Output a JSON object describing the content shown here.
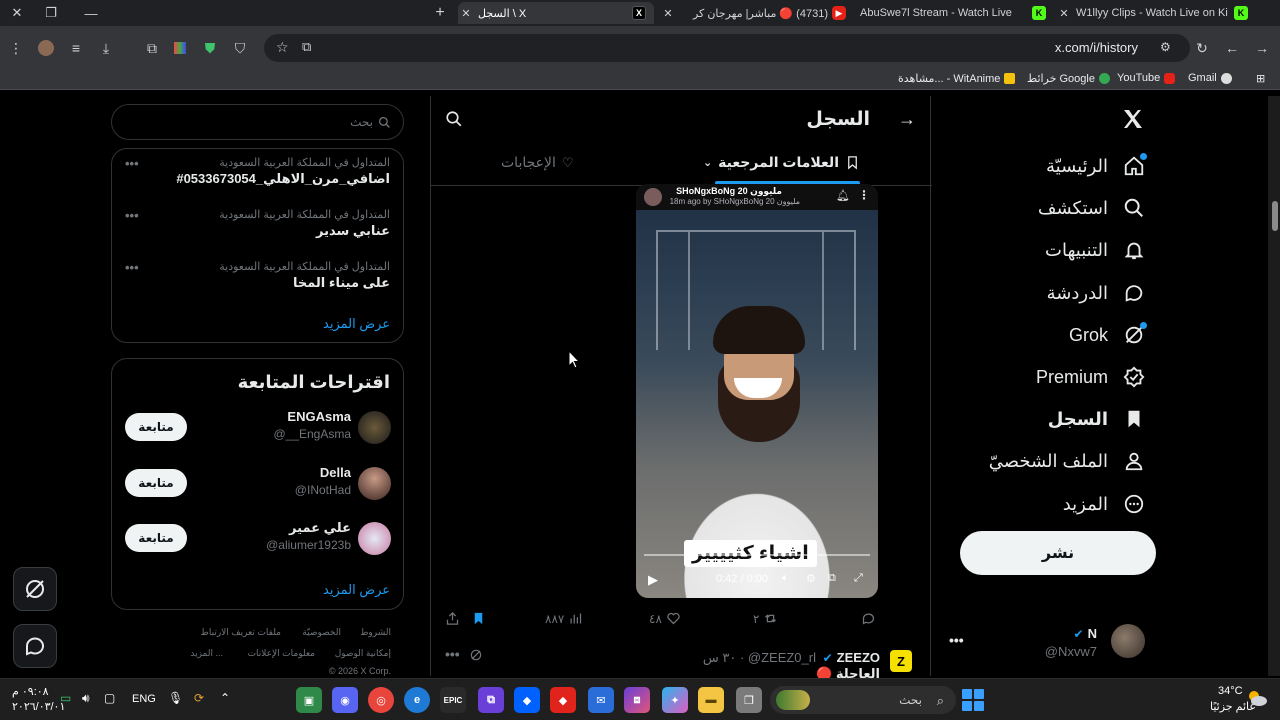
{
  "browser": {
    "tabs": [
      {
        "title": "السجل \\ X",
        "favicon": "x-favicon",
        "active": true
      },
      {
        "title": "(4731) 🔴 مباشر| مهرجان كر",
        "favicon": "youtube-favicon",
        "active": false
      },
      {
        "title": "AbuSwe7l Stream - Watch Live",
        "favicon": "kick-favicon",
        "active": false
      },
      {
        "title": "W1llyy Clips - Watch Live on Ki",
        "favicon": "kick-favicon",
        "active": false
      }
    ],
    "url": "x.com/i/history",
    "bookmarks": [
      {
        "label": "Gmail",
        "icon": "gmail-icon"
      },
      {
        "label": "YouTube",
        "icon": "youtube-icon"
      },
      {
        "label": "خرائط Google",
        "icon": "maps-icon"
      },
      {
        "label": "مشاهدة... - WitAnime",
        "icon": "witanime-icon"
      }
    ]
  },
  "nav": {
    "items": [
      {
        "label": "الرئيسيّة",
        "icon": "home-icon",
        "bold": false,
        "dot": true
      },
      {
        "label": "استكشف",
        "icon": "search-icon",
        "bold": false,
        "dot": false
      },
      {
        "label": "التنبيهات",
        "icon": "bell-icon",
        "bold": false,
        "dot": false
      },
      {
        "label": "الدردشة",
        "icon": "chat-icon",
        "bold": false,
        "dot": false
      },
      {
        "label": "Grok",
        "icon": "grok-icon",
        "bold": false,
        "dot": true
      },
      {
        "label": "Premium",
        "icon": "premium-icon",
        "bold": false,
        "dot": false
      },
      {
        "label": "السجل",
        "icon": "bookmark-icon",
        "bold": true,
        "dot": false
      },
      {
        "label": "الملف الشخصيّ",
        "icon": "profile-icon",
        "bold": false,
        "dot": false
      },
      {
        "label": "المزيد",
        "icon": "more-icon",
        "bold": false,
        "dot": false
      }
    ],
    "post_label": "نشر",
    "me": {
      "name": "N",
      "handle": "@Nxvw7"
    }
  },
  "center": {
    "title": "السجل",
    "tabs": [
      {
        "label": "العلامات المرجعية",
        "active": true
      },
      {
        "label": "الإعجابات",
        "active": false
      }
    ],
    "embed": {
      "name": "SHoNgxBoNg 20 مليوون",
      "sub": "18m ago by SHoNgxBoNg 20 مليوون",
      "caption": "اشياء كثيييير",
      "time": "0:42 / 0:00"
    },
    "actions": {
      "views": "٨٨٧",
      "likes": "٤٨",
      "reposts": "٢"
    },
    "next_tweet": {
      "name": "ZEEZO",
      "handle": "@ZEEZ0_rl",
      "time": "٣٠ س",
      "text": "🔴 العاجلة"
    }
  },
  "sidebar": {
    "search_placeholder": "بحث",
    "trends": [
      {
        "meta": "المتداول في المملكة العربية السعودية",
        "name": "#اضافي_مرن_الاهلي_0533673054"
      },
      {
        "meta": "المتداول في المملكة العربية السعودية",
        "name": "عنابي سدير"
      },
      {
        "meta": "المتداول في المملكة العربية السعودية",
        "name": "على ميناء المخا"
      }
    ],
    "show_more": "عرض المزيد",
    "who_title": "اقتراحات المتابعة",
    "who": [
      {
        "name": "ENGAsma",
        "handle": "@__EngAsma",
        "button": "متابعة"
      },
      {
        "name": "Della",
        "handle": "@INotHad",
        "button": "متابعة"
      },
      {
        "name": "علي عمير",
        "handle": "@aliumer1923b",
        "button": "متابعة"
      }
    ],
    "footer": [
      "الشروط",
      "الخصوصيّة",
      "ملفات تعريف الارتباط",
      "إمكانية الوصول",
      "معلومات الإعلانات",
      "المزيد ...",
      "© 2026 X Corp."
    ]
  },
  "taskbar": {
    "time": "٠٩:٠٨ م",
    "date": "٢٠٢٦/٠٣/٠١",
    "lang": "ENG",
    "search_placeholder": "بحث",
    "weather_temp": "34°C",
    "weather_desc": "غائم جزئيًا"
  }
}
